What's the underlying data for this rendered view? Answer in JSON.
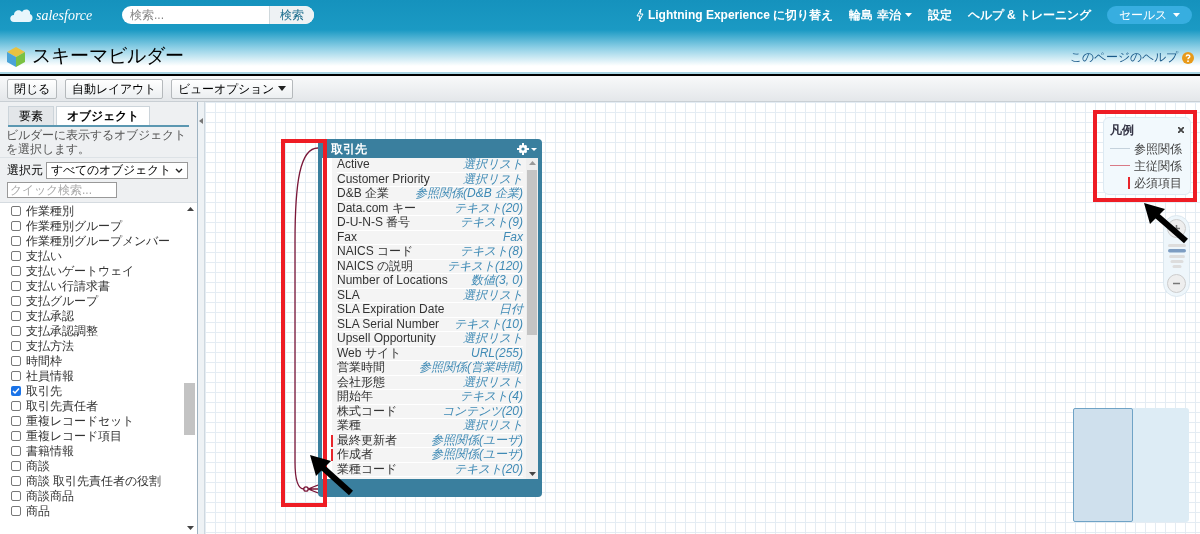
{
  "header": {
    "logo": "salesforce",
    "search": {
      "placeholder": "検索...",
      "button": "検索"
    },
    "nav": [
      {
        "label": "Lightning Experience に切り替え",
        "kind": "switch"
      },
      {
        "label": "輪島 幸治",
        "kind": "menu"
      },
      {
        "label": "設定",
        "kind": "link"
      },
      {
        "label": "ヘルプ & トレーニング",
        "kind": "link"
      }
    ],
    "app_menu": "セールス"
  },
  "page": {
    "title": "スキーマビルダー",
    "help_link": "このページのヘルプ"
  },
  "toolbar": [
    {
      "label": "閉じる",
      "dropdown": false
    },
    {
      "label": "自動レイアウト",
      "dropdown": false
    },
    {
      "label": "ビューオプション",
      "dropdown": true
    }
  ],
  "sidebar": {
    "tabs": [
      {
        "label": "要素",
        "selected": false
      },
      {
        "label": "オブジェクト",
        "selected": true
      }
    ],
    "hint": "ビルダーに表示するオブジェクトを選択します。",
    "filter": {
      "label": "選択元",
      "value": "すべてのオブジェクト"
    },
    "quick_search": {
      "placeholder": "クイック検索..."
    },
    "objects": [
      {
        "label": "作業種別",
        "checked": false
      },
      {
        "label": "作業種別グループ",
        "checked": false
      },
      {
        "label": "作業種別グループメンバー",
        "checked": false
      },
      {
        "label": "支払い",
        "checked": false
      },
      {
        "label": "支払いゲートウェイ",
        "checked": false
      },
      {
        "label": "支払い行請求書",
        "checked": false
      },
      {
        "label": "支払グループ",
        "checked": false
      },
      {
        "label": "支払承認",
        "checked": false
      },
      {
        "label": "支払承認調整",
        "checked": false
      },
      {
        "label": "支払方法",
        "checked": false
      },
      {
        "label": "時間枠",
        "checked": false
      },
      {
        "label": "社員情報",
        "checked": false
      },
      {
        "label": "取引先",
        "checked": true
      },
      {
        "label": "取引先責任者",
        "checked": false
      },
      {
        "label": "重複レコードセット",
        "checked": false
      },
      {
        "label": "重複レコード項目",
        "checked": false
      },
      {
        "label": "書籍情報",
        "checked": false
      },
      {
        "label": "商談",
        "checked": false
      },
      {
        "label": "商談 取引先責任者の役割",
        "checked": false
      },
      {
        "label": "商談商品",
        "checked": false
      },
      {
        "label": "商品",
        "checked": false
      }
    ]
  },
  "canvas": {
    "object_card": {
      "title": "取引先",
      "fields": [
        {
          "label": "Active",
          "type": "選択リスト",
          "required": false
        },
        {
          "label": "Customer Priority",
          "type": "選択リスト",
          "required": false
        },
        {
          "label": "D&B 企業",
          "type": "参照関係(D&B 企業)",
          "required": false
        },
        {
          "label": "Data.com キー",
          "type": "テキスト(20)",
          "required": false
        },
        {
          "label": "D-U-N-S 番号",
          "type": "テキスト(9)",
          "required": false
        },
        {
          "label": "Fax",
          "type": "Fax",
          "required": false
        },
        {
          "label": "NAICS コード",
          "type": "テキスト(8)",
          "required": false
        },
        {
          "label": "NAICS の説明",
          "type": "テキスト(120)",
          "required": false
        },
        {
          "label": "Number of Locations",
          "type": "数値(3, 0)",
          "required": false
        },
        {
          "label": "SLA",
          "type": "選択リスト",
          "required": false
        },
        {
          "label": "SLA Expiration Date",
          "type": "日付",
          "required": false
        },
        {
          "label": "SLA Serial Number",
          "type": "テキスト(10)",
          "required": false
        },
        {
          "label": "Upsell Opportunity",
          "type": "選択リスト",
          "required": false
        },
        {
          "label": "Web サイト",
          "type": "URL(255)",
          "required": false
        },
        {
          "label": "営業時間",
          "type": "参照関係(営業時間)",
          "required": false
        },
        {
          "label": "会社形態",
          "type": "選択リスト",
          "required": false
        },
        {
          "label": "開始年",
          "type": "テキスト(4)",
          "required": false
        },
        {
          "label": "株式コード",
          "type": "コンテンツ(20)",
          "required": false
        },
        {
          "label": "業種",
          "type": "選択リスト",
          "required": false
        },
        {
          "label": "最終更新者",
          "type": "参照関係(ユーザ)",
          "required": true
        },
        {
          "label": "作成者",
          "type": "参照関係(ユーザ)",
          "required": true
        },
        {
          "label": "業種コード",
          "type": "テキスト(20)",
          "required": false
        }
      ]
    },
    "legend": {
      "title": "凡例",
      "items": [
        {
          "label": "参照関係",
          "kind": "lookup"
        },
        {
          "label": "主従関係",
          "kind": "master_detail"
        },
        {
          "label": "必須項目",
          "kind": "required"
        }
      ]
    }
  }
}
